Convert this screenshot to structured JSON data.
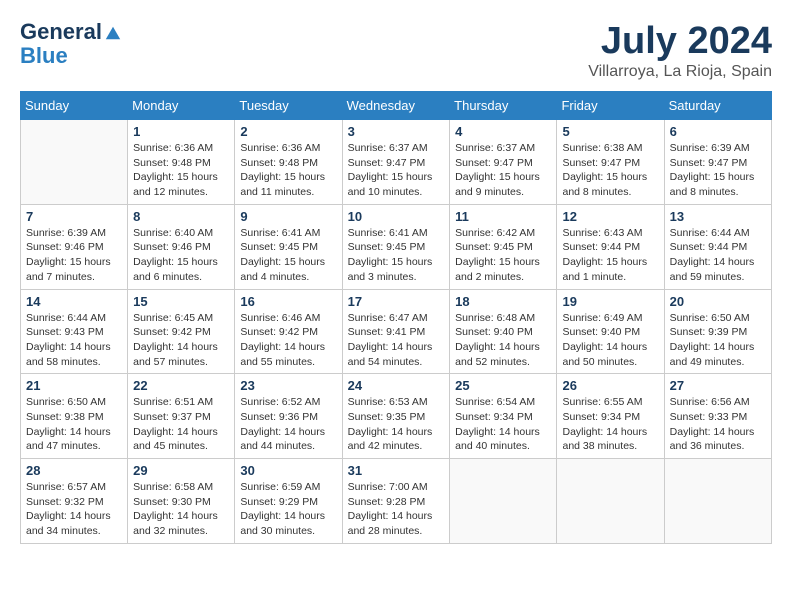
{
  "header": {
    "logo_line1": "General",
    "logo_line2": "Blue",
    "month_year": "July 2024",
    "location": "Villarroya, La Rioja, Spain"
  },
  "calendar": {
    "days_of_week": [
      "Sunday",
      "Monday",
      "Tuesday",
      "Wednesday",
      "Thursday",
      "Friday",
      "Saturday"
    ],
    "weeks": [
      [
        {
          "day": "",
          "info": ""
        },
        {
          "day": "1",
          "info": "Sunrise: 6:36 AM\nSunset: 9:48 PM\nDaylight: 15 hours\nand 12 minutes."
        },
        {
          "day": "2",
          "info": "Sunrise: 6:36 AM\nSunset: 9:48 PM\nDaylight: 15 hours\nand 11 minutes."
        },
        {
          "day": "3",
          "info": "Sunrise: 6:37 AM\nSunset: 9:47 PM\nDaylight: 15 hours\nand 10 minutes."
        },
        {
          "day": "4",
          "info": "Sunrise: 6:37 AM\nSunset: 9:47 PM\nDaylight: 15 hours\nand 9 minutes."
        },
        {
          "day": "5",
          "info": "Sunrise: 6:38 AM\nSunset: 9:47 PM\nDaylight: 15 hours\nand 8 minutes."
        },
        {
          "day": "6",
          "info": "Sunrise: 6:39 AM\nSunset: 9:47 PM\nDaylight: 15 hours\nand 8 minutes."
        }
      ],
      [
        {
          "day": "7",
          "info": "Sunrise: 6:39 AM\nSunset: 9:46 PM\nDaylight: 15 hours\nand 7 minutes."
        },
        {
          "day": "8",
          "info": "Sunrise: 6:40 AM\nSunset: 9:46 PM\nDaylight: 15 hours\nand 6 minutes."
        },
        {
          "day": "9",
          "info": "Sunrise: 6:41 AM\nSunset: 9:45 PM\nDaylight: 15 hours\nand 4 minutes."
        },
        {
          "day": "10",
          "info": "Sunrise: 6:41 AM\nSunset: 9:45 PM\nDaylight: 15 hours\nand 3 minutes."
        },
        {
          "day": "11",
          "info": "Sunrise: 6:42 AM\nSunset: 9:45 PM\nDaylight: 15 hours\nand 2 minutes."
        },
        {
          "day": "12",
          "info": "Sunrise: 6:43 AM\nSunset: 9:44 PM\nDaylight: 15 hours\nand 1 minute."
        },
        {
          "day": "13",
          "info": "Sunrise: 6:44 AM\nSunset: 9:44 PM\nDaylight: 14 hours\nand 59 minutes."
        }
      ],
      [
        {
          "day": "14",
          "info": "Sunrise: 6:44 AM\nSunset: 9:43 PM\nDaylight: 14 hours\nand 58 minutes."
        },
        {
          "day": "15",
          "info": "Sunrise: 6:45 AM\nSunset: 9:42 PM\nDaylight: 14 hours\nand 57 minutes."
        },
        {
          "day": "16",
          "info": "Sunrise: 6:46 AM\nSunset: 9:42 PM\nDaylight: 14 hours\nand 55 minutes."
        },
        {
          "day": "17",
          "info": "Sunrise: 6:47 AM\nSunset: 9:41 PM\nDaylight: 14 hours\nand 54 minutes."
        },
        {
          "day": "18",
          "info": "Sunrise: 6:48 AM\nSunset: 9:40 PM\nDaylight: 14 hours\nand 52 minutes."
        },
        {
          "day": "19",
          "info": "Sunrise: 6:49 AM\nSunset: 9:40 PM\nDaylight: 14 hours\nand 50 minutes."
        },
        {
          "day": "20",
          "info": "Sunrise: 6:50 AM\nSunset: 9:39 PM\nDaylight: 14 hours\nand 49 minutes."
        }
      ],
      [
        {
          "day": "21",
          "info": "Sunrise: 6:50 AM\nSunset: 9:38 PM\nDaylight: 14 hours\nand 47 minutes."
        },
        {
          "day": "22",
          "info": "Sunrise: 6:51 AM\nSunset: 9:37 PM\nDaylight: 14 hours\nand 45 minutes."
        },
        {
          "day": "23",
          "info": "Sunrise: 6:52 AM\nSunset: 9:36 PM\nDaylight: 14 hours\nand 44 minutes."
        },
        {
          "day": "24",
          "info": "Sunrise: 6:53 AM\nSunset: 9:35 PM\nDaylight: 14 hours\nand 42 minutes."
        },
        {
          "day": "25",
          "info": "Sunrise: 6:54 AM\nSunset: 9:34 PM\nDaylight: 14 hours\nand 40 minutes."
        },
        {
          "day": "26",
          "info": "Sunrise: 6:55 AM\nSunset: 9:34 PM\nDaylight: 14 hours\nand 38 minutes."
        },
        {
          "day": "27",
          "info": "Sunrise: 6:56 AM\nSunset: 9:33 PM\nDaylight: 14 hours\nand 36 minutes."
        }
      ],
      [
        {
          "day": "28",
          "info": "Sunrise: 6:57 AM\nSunset: 9:32 PM\nDaylight: 14 hours\nand 34 minutes."
        },
        {
          "day": "29",
          "info": "Sunrise: 6:58 AM\nSunset: 9:30 PM\nDaylight: 14 hours\nand 32 minutes."
        },
        {
          "day": "30",
          "info": "Sunrise: 6:59 AM\nSunset: 9:29 PM\nDaylight: 14 hours\nand 30 minutes."
        },
        {
          "day": "31",
          "info": "Sunrise: 7:00 AM\nSunset: 9:28 PM\nDaylight: 14 hours\nand 28 minutes."
        },
        {
          "day": "",
          "info": ""
        },
        {
          "day": "",
          "info": ""
        },
        {
          "day": "",
          "info": ""
        }
      ]
    ]
  }
}
